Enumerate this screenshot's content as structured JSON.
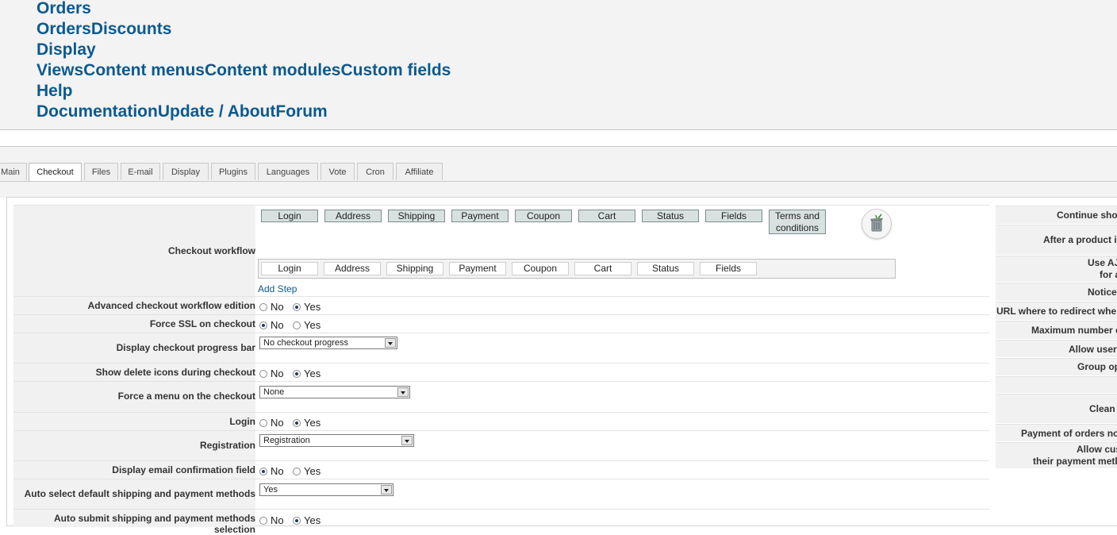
{
  "top_menu": {
    "lines": [
      "Orders",
      "OrdersDiscounts",
      "Display",
      "ViewsContent menusContent modulesCustom fields",
      "Help",
      "DocumentationUpdate / AboutForum"
    ]
  },
  "tabs": [
    "Main",
    "Checkout",
    "Files",
    "E-mail",
    "Display",
    "Plugins",
    "Languages",
    "Vote",
    "Cron",
    "Affiliate"
  ],
  "active_tab": "Checkout",
  "workflow": {
    "label": "Checkout workflow",
    "row1": [
      "Login",
      "Address",
      "Shipping",
      "Payment",
      "Coupon",
      "Cart",
      "Status",
      "Fields",
      "Terms and conditions"
    ],
    "row1_line1": "Terms and",
    "row1_line2": "conditions",
    "row2": [
      "Login",
      "Address",
      "Shipping",
      "Payment",
      "Coupon",
      "Cart",
      "Status",
      "Fields"
    ],
    "add_step": "Add Step",
    "trash_icon": "trash-icon"
  },
  "options": {
    "no": "No",
    "yes": "Yes"
  },
  "fields": {
    "advanced_workflow": {
      "label": "Advanced checkout workflow edition",
      "value": "Yes"
    },
    "force_ssl": {
      "label": "Force SSL on checkout",
      "value": "No"
    },
    "progress_bar": {
      "label": "Display checkout progress bar",
      "value": "No checkout progress"
    },
    "delete_icons": {
      "label": "Show delete icons during checkout",
      "value": "Yes"
    },
    "force_menu": {
      "label": "Force a menu on the checkout",
      "value": "None"
    },
    "login": {
      "label": "Login",
      "value": "Yes"
    },
    "registration": {
      "label": "Registration",
      "value": "Registration"
    },
    "email_confirm": {
      "label": "Display email confirmation field",
      "value": "No"
    },
    "auto_select": {
      "label": "Auto select default shipping and payment methods",
      "value": "Yes"
    },
    "auto_submit": {
      "label": "Auto submit shipping and payment methods selection",
      "value": "Yes"
    }
  },
  "right_column": [
    [
      "Continue shop"
    ],
    [
      "After a product is"
    ],
    [
      "Use AJ",
      "for a"
    ],
    [
      "Notice p"
    ],
    [
      "URL where to redirect whe"
    ],
    [
      "Maximum number o"
    ],
    [
      "Allow user"
    ],
    [
      "Group op"
    ],
    [
      ""
    ],
    [
      "Clean"
    ],
    [
      "Payment of orders no"
    ],
    [
      "Allow cus",
      "their payment meth"
    ]
  ],
  "colors": {
    "link": "#0b5a8e",
    "label_bg": "#f1f1f1",
    "step_bg": "#d8e0e0"
  }
}
